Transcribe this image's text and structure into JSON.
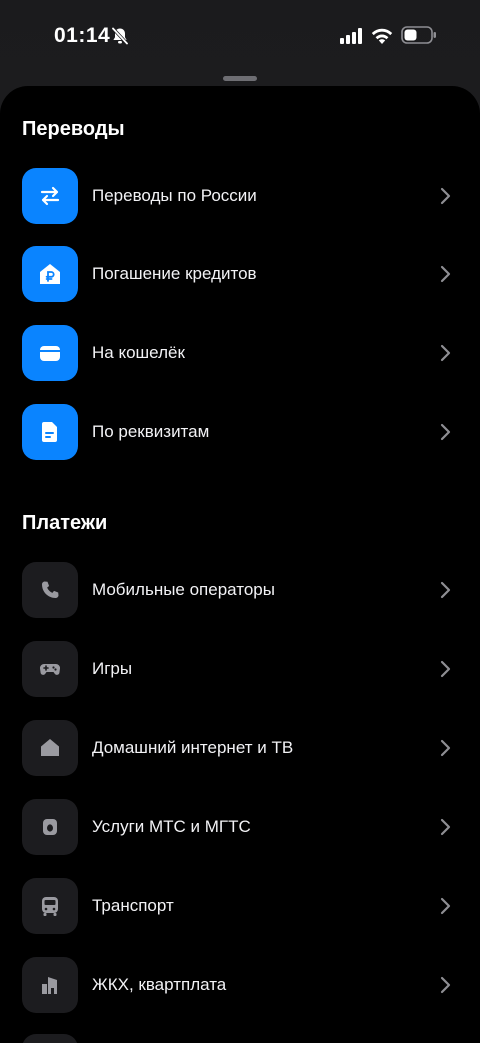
{
  "status_bar": {
    "time": "01:14"
  },
  "sections": {
    "transfers": {
      "title": "Переводы",
      "items": [
        {
          "label": "Переводы по России",
          "icon": "arrows-swap-icon"
        },
        {
          "label": "Погашение кредитов",
          "icon": "house-ruble-icon"
        },
        {
          "label": "На кошелёк",
          "icon": "wallet-icon"
        },
        {
          "label": "По реквизитам",
          "icon": "document-icon"
        }
      ]
    },
    "payments": {
      "title": "Платежи",
      "items": [
        {
          "label": "Мобильные операторы",
          "icon": "phone-icon"
        },
        {
          "label": "Игры",
          "icon": "gamepad-icon"
        },
        {
          "label": "Домашний интернет и ТВ",
          "icon": "home-icon"
        },
        {
          "label": "Услуги МТС и МГТС",
          "icon": "mts-icon"
        },
        {
          "label": "Транспорт",
          "icon": "bus-icon"
        },
        {
          "label": "ЖКХ, квартплата",
          "icon": "buildings-icon"
        }
      ]
    }
  },
  "colors": {
    "accent": "#0a84ff",
    "sheet_background": "#000000",
    "tile_dark": "#1c1c1f",
    "chevron": "#8e8e93",
    "icon_gray": "#9a9aa0"
  }
}
